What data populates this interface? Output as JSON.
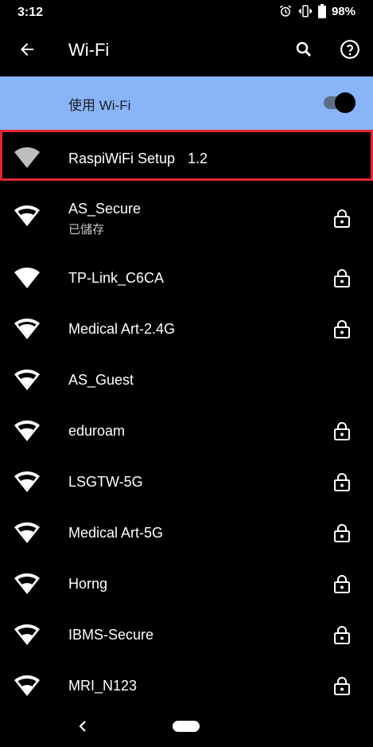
{
  "status": {
    "time": "3:12",
    "battery": "98%"
  },
  "app_bar": {
    "title": "Wi-Fi"
  },
  "toggle": {
    "label": "使用 Wi-Fi",
    "enabled": true
  },
  "networks": [
    {
      "name": "RaspiWiFi Setup",
      "version": "1.2",
      "secured": false,
      "highlighted": true
    },
    {
      "name": "AS_Secure",
      "subtitle": "已儲存",
      "secured": true
    },
    {
      "name": "TP-Link_C6CA",
      "secured": true
    },
    {
      "name": "Medical Art-2.4G",
      "secured": true
    },
    {
      "name": "AS_Guest",
      "secured": false
    },
    {
      "name": "eduroam",
      "secured": true
    },
    {
      "name": "LSGTW-5G",
      "secured": true
    },
    {
      "name": "Medical Art-5G",
      "secured": true
    },
    {
      "name": "Horng",
      "secured": true
    },
    {
      "name": "IBMS-Secure",
      "secured": true
    },
    {
      "name": "MRI_N123",
      "secured": true
    }
  ],
  "colors": {
    "toggle_bg": "#8ab4f8",
    "highlight_border": "#e3262f",
    "background": "#000000"
  }
}
